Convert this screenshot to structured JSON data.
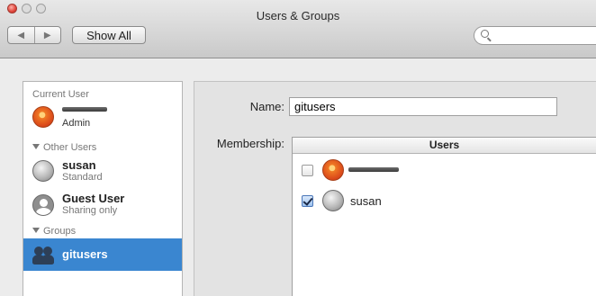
{
  "window": {
    "title": "Users & Groups"
  },
  "toolbar": {
    "back_icon": "◀",
    "forward_icon": "▶",
    "show_all_label": "Show All",
    "search_value": "",
    "search_placeholder": ""
  },
  "sidebar": {
    "current_user_header": "Current User",
    "current_user": {
      "name": "",
      "role": "Admin",
      "icon": "flower-avatar-icon"
    },
    "other_users_header": "Other Users",
    "other_users": [
      {
        "name": "susan",
        "role": "Standard",
        "icon": "gray-avatar-icon"
      },
      {
        "name": "Guest User",
        "role": "Sharing only",
        "icon": "guest-silhouette-icon"
      }
    ],
    "groups_header": "Groups",
    "groups": [
      {
        "name": "gitusers",
        "selected": true,
        "icon": "group-people-icon"
      }
    ]
  },
  "detail": {
    "name_label": "Name:",
    "name_value": "gitusers",
    "membership_label": "Membership:",
    "members_column_header": "Users",
    "members": [
      {
        "name": "",
        "checked": false,
        "icon": "flower-avatar-icon"
      },
      {
        "name": "susan",
        "checked": true,
        "icon": "gray-avatar-icon"
      }
    ]
  },
  "colors": {
    "selection_blue": "#3a86d0",
    "window_bg": "#ececec",
    "pane_bg": "#e3e3e3"
  }
}
